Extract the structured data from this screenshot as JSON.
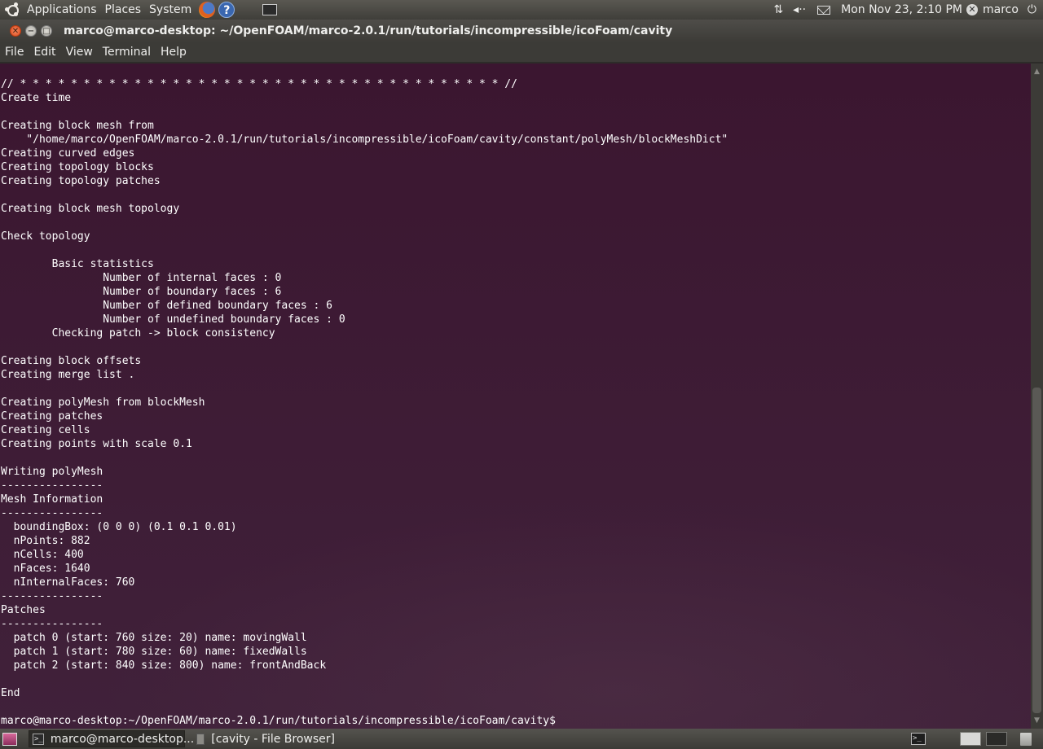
{
  "top_panel": {
    "menus": [
      "Applications",
      "Places",
      "System"
    ],
    "clock": "Mon Nov 23,  2:10 PM",
    "user": "marco",
    "icons": [
      "ubuntu-logo-icon",
      "firefox-icon",
      "help-icon",
      "show-desktop-icon",
      "network-icon",
      "volume-icon",
      "mail-icon",
      "user-icon",
      "power-icon"
    ]
  },
  "window": {
    "title": "marco@marco-desktop: ~/OpenFOAM/marco-2.0.1/run/tutorials/incompressible/icoFoam/cavity",
    "menus": [
      "File",
      "Edit",
      "View",
      "Terminal",
      "Help"
    ]
  },
  "terminal": {
    "lines": [
      "// * * * * * * * * * * * * * * * * * * * * * * * * * * * * * * * * * * * * * * //",
      "Create time",
      "",
      "Creating block mesh from",
      "    \"/home/marco/OpenFOAM/marco-2.0.1/run/tutorials/incompressible/icoFoam/cavity/constant/polyMesh/blockMeshDict\"",
      "Creating curved edges",
      "Creating topology blocks",
      "Creating topology patches",
      "",
      "Creating block mesh topology",
      "",
      "Check topology",
      "",
      "        Basic statistics",
      "                Number of internal faces : 0",
      "                Number of boundary faces : 6",
      "                Number of defined boundary faces : 6",
      "                Number of undefined boundary faces : 0",
      "        Checking patch -> block consistency",
      "",
      "Creating block offsets",
      "Creating merge list .",
      "",
      "Creating polyMesh from blockMesh",
      "Creating patches",
      "Creating cells",
      "Creating points with scale 0.1",
      "",
      "Writing polyMesh",
      "----------------",
      "Mesh Information",
      "----------------",
      "  boundingBox: (0 0 0) (0.1 0.1 0.01)",
      "  nPoints: 882",
      "  nCells: 400",
      "  nFaces: 1640",
      "  nInternalFaces: 760",
      "----------------",
      "Patches",
      "----------------",
      "  patch 0 (start: 760 size: 20) name: movingWall",
      "  patch 1 (start: 780 size: 60) name: fixedWalls",
      "  patch 2 (start: 840 size: 800) name: frontAndBack",
      "",
      "End",
      "",
      "marco@marco-desktop:~/OpenFOAM/marco-2.0.1/run/tutorials/incompressible/icoFoam/cavity$"
    ]
  },
  "taskbar": {
    "tasks": [
      "marco@marco-desktop...",
      "[cavity - File Browser]"
    ]
  },
  "colors": {
    "terminal_bg": "#3b1630",
    "terminal_fg": "#ffffff",
    "panel_bg": "#3c3b37",
    "close_button": "#e0532a"
  }
}
